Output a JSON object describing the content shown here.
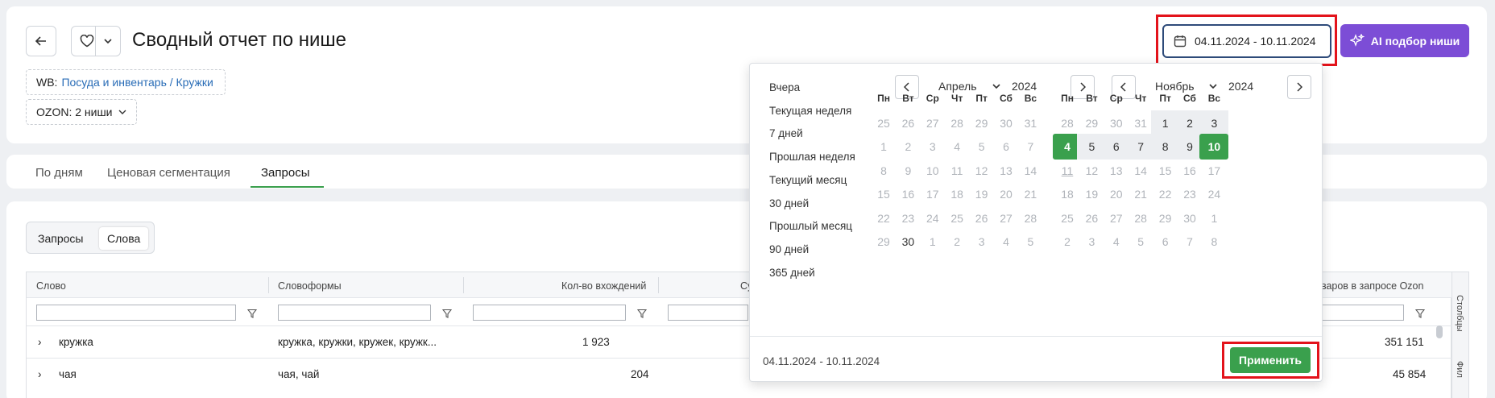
{
  "header": {
    "title": "Сводный отчет по нише",
    "wb_prefix": "WB:",
    "wb_link": "Посуда и инвентарь / Кружки",
    "ozon": "OZON: 2 ниши",
    "date_range": "04.11.2024 - 10.11.2024",
    "ai_button": "AI подбор ниши"
  },
  "tabs": [
    "По дням",
    "Ценовая сегментация",
    "Запросы"
  ],
  "segment": [
    "Запросы",
    "Слова"
  ],
  "grid": {
    "columns": [
      "Слово",
      "Словоформы",
      "Кол-во вхождений",
      "Су",
      "оваров в запросе Ozon"
    ],
    "rows": [
      {
        "word": "кружка",
        "forms": "кружка, кружки, кружек, кружк...",
        "count": "1 923",
        "ozon": "351 151"
      },
      {
        "word": "чая",
        "forms": "чая, чай",
        "count": "204",
        "ozon": "45 854"
      }
    ],
    "side_tabs": [
      "Столбцы",
      "Фил"
    ]
  },
  "datepicker": {
    "presets": [
      "Вчера",
      "Текущая неделя",
      "7 дней",
      "Прошлая неделя",
      "Текущий месяц",
      "30 дней",
      "Прошлый месяц",
      "90 дней",
      "365 дней"
    ],
    "weekdays": [
      "Пн",
      "Вт",
      "Ср",
      "Чт",
      "Пт",
      "Сб",
      "Вс"
    ],
    "left": {
      "month": "Апрель",
      "year": "2024",
      "days": [
        "25",
        "26",
        "27",
        "28",
        "29",
        "30",
        "31",
        "1",
        "2",
        "3",
        "4",
        "5",
        "6",
        "7",
        "8",
        "9",
        "10",
        "11",
        "12",
        "13",
        "14",
        "15",
        "16",
        "17",
        "18",
        "19",
        "20",
        "21",
        "22",
        "23",
        "24",
        "25",
        "26",
        "27",
        "28",
        "29",
        "30",
        "1",
        "2",
        "3",
        "4",
        "5"
      ]
    },
    "right": {
      "month": "Ноябрь",
      "year": "2024",
      "days": [
        "28",
        "29",
        "30",
        "31",
        "1",
        "2",
        "3",
        "4",
        "5",
        "6",
        "7",
        "8",
        "9",
        "10",
        "11",
        "12",
        "13",
        "14",
        "15",
        "16",
        "17",
        "18",
        "19",
        "20",
        "21",
        "22",
        "23",
        "24",
        "25",
        "26",
        "27",
        "28",
        "29",
        "30",
        "1",
        "2",
        "3",
        "4",
        "5",
        "6",
        "7",
        "8"
      ]
    },
    "footer_range": "04.11.2024 - 10.11.2024",
    "apply": "Применить"
  },
  "colors": {
    "accent": "#3aa04d",
    "ai": "#7c4dd6",
    "highlight": "#e3131b"
  }
}
